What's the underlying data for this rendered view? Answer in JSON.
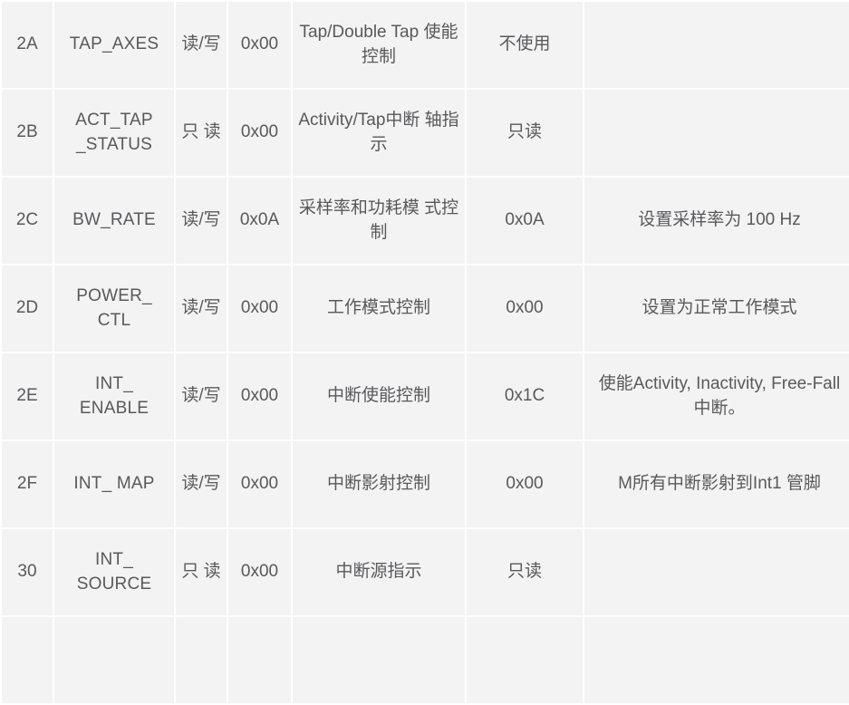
{
  "table": {
    "columns": [
      "address",
      "register_name",
      "access",
      "default_value",
      "description",
      "set_value",
      "note"
    ],
    "rows": [
      {
        "address": "2A",
        "register_name": "TAP_AXES",
        "access": "读/写",
        "default_value": "0x00",
        "description": "Tap/Double Tap 使能控制",
        "set_value": "不使用",
        "note": ""
      },
      {
        "address": "2B",
        "register_name": "ACT_TAP _STATUS",
        "access": "只 读",
        "default_value": "0x00",
        "description": "Activity/Tap中断 轴指示",
        "set_value": "只读",
        "note": ""
      },
      {
        "address": "2C",
        "register_name": "BW_RATE",
        "access": "读/写",
        "default_value": "0x0A",
        "description": "采样率和功耗模 式控制",
        "set_value": "0x0A",
        "note": "设置采样率为 100 Hz"
      },
      {
        "address": "2D",
        "register_name": "POWER_ CTL",
        "access": "读/写",
        "default_value": "0x00",
        "description": "工作模式控制",
        "set_value": "0x00",
        "note": "设置为正常工作模式"
      },
      {
        "address": "2E",
        "register_name": "INT_ ENABLE",
        "access": "读/写",
        "default_value": "0x00",
        "description": "中断使能控制",
        "set_value": "0x1C",
        "note": "使能Activity, Inactivity, Free-Fall 中断。"
      },
      {
        "address": "2F",
        "register_name": "INT_ MAP",
        "access": "读/写",
        "default_value": "0x00",
        "description": "中断影射控制",
        "set_value": "0x00",
        "note": "M所有中断影射到Int1 管脚"
      },
      {
        "address": "30",
        "register_name": "INT_ SOURCE",
        "access": "只 读",
        "default_value": "0x00",
        "description": "中断源指示",
        "set_value": "只读",
        "note": ""
      }
    ]
  },
  "colors": {
    "cell_background": "#f3f3f3",
    "page_background": "#ffffff",
    "text": "#59585b"
  }
}
